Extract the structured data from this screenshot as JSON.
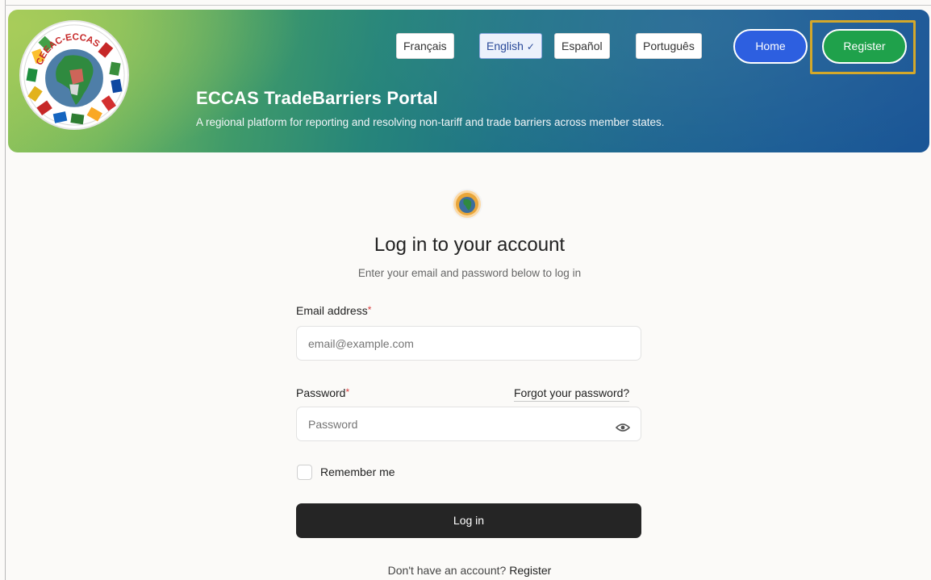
{
  "header": {
    "title": "ECCAS TradeBarriers Portal",
    "subtitle": "A regional platform for reporting and resolving non-tariff and trade barriers across member states.",
    "logo_text": "CEEAC-ECCAS",
    "languages": [
      {
        "label": "Français",
        "active": false
      },
      {
        "label": "English",
        "active": true
      },
      {
        "label": "Español",
        "active": false
      },
      {
        "label": "Português",
        "active": false
      }
    ],
    "active_check": "✓",
    "home_label": "Home",
    "register_label": "Register"
  },
  "login": {
    "title": "Log in to your account",
    "subtitle": "Enter your email and password below to log in",
    "email_label": "Email address",
    "email_placeholder": "email@example.com",
    "password_label": "Password",
    "password_placeholder": "Password",
    "required_mark": "*",
    "forgot_label": "Forgot your password?",
    "remember_label": "Remember me",
    "login_button": "Log in",
    "no_account_text": "Don't have an account?",
    "register_link": "Register"
  },
  "colors": {
    "accent_blue": "#2d5fe0",
    "accent_green": "#1fa14b",
    "highlight": "#d4a82a",
    "login_button": "#252525"
  }
}
